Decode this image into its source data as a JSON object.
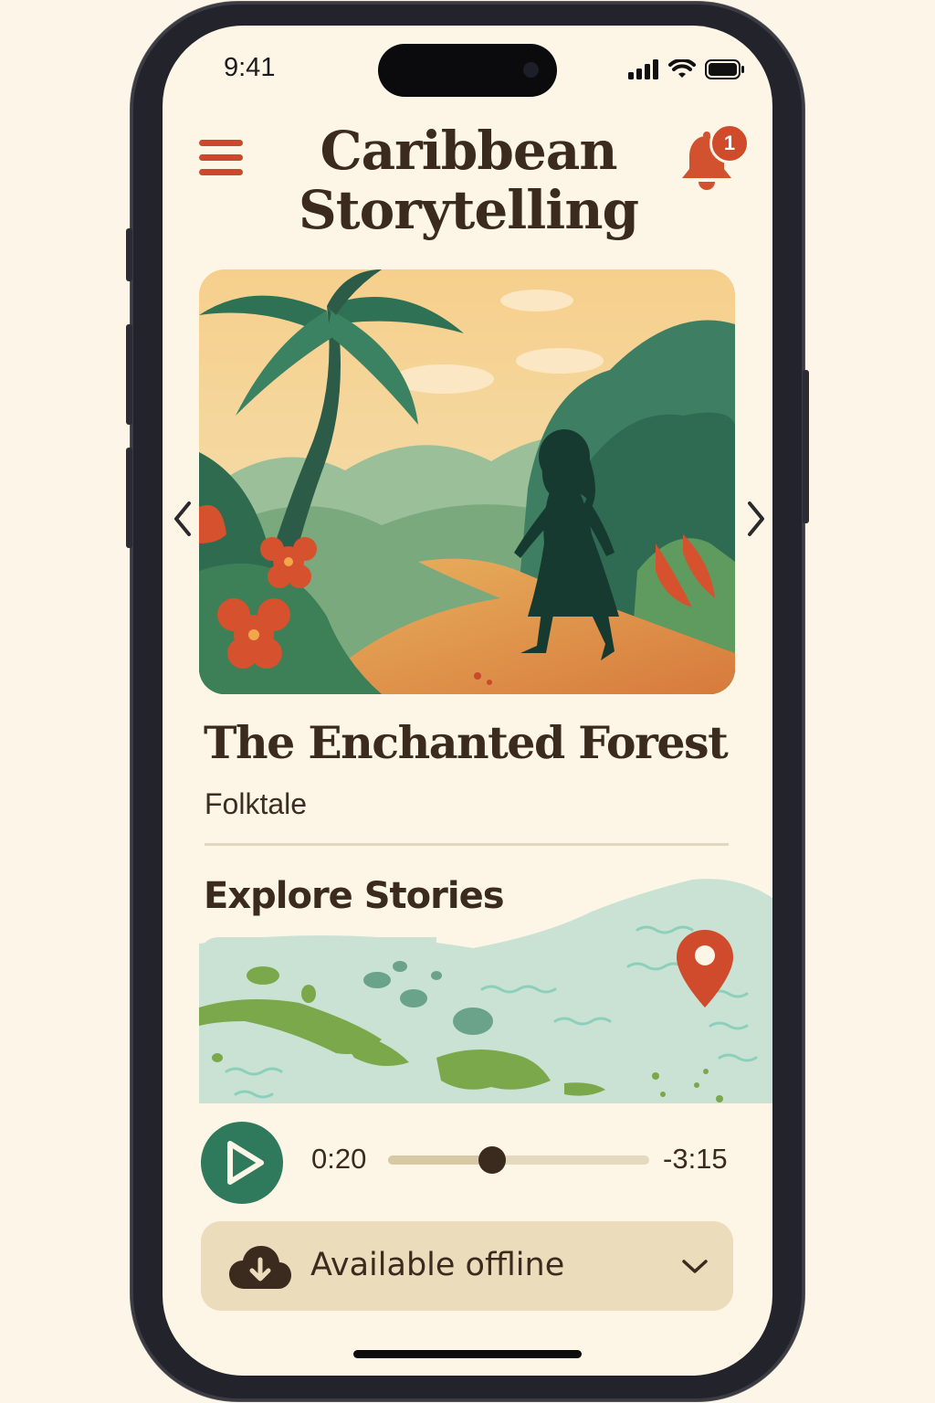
{
  "status_bar": {
    "time": "9:41",
    "icons": [
      "signal-icon",
      "wifi-icon",
      "battery-icon"
    ]
  },
  "header": {
    "title_line1": "Caribbean",
    "title_line2": "Storytelling",
    "notification_count": "1",
    "menu_icon": "hamburger-menu-icon",
    "bell_icon": "bell-icon"
  },
  "featured_story": {
    "title": "The Enchanted Forest",
    "genre": "Folktale",
    "image": "jungle-path-silhouette-illustration"
  },
  "explore": {
    "title": "Explore Stories",
    "map": "caribbean-map-with-pin"
  },
  "player": {
    "elapsed": "0:20",
    "remaining": "-3:15",
    "progress": 0.4
  },
  "offline": {
    "label": "Available offline",
    "icon": "cloud-download-icon"
  },
  "colors": {
    "background": "#fdf5e6",
    "accent_red": "#c8492b",
    "accent_green": "#2f7a5c",
    "text_dark": "#3b2a1e",
    "offline_bg": "#ebdcbb"
  }
}
